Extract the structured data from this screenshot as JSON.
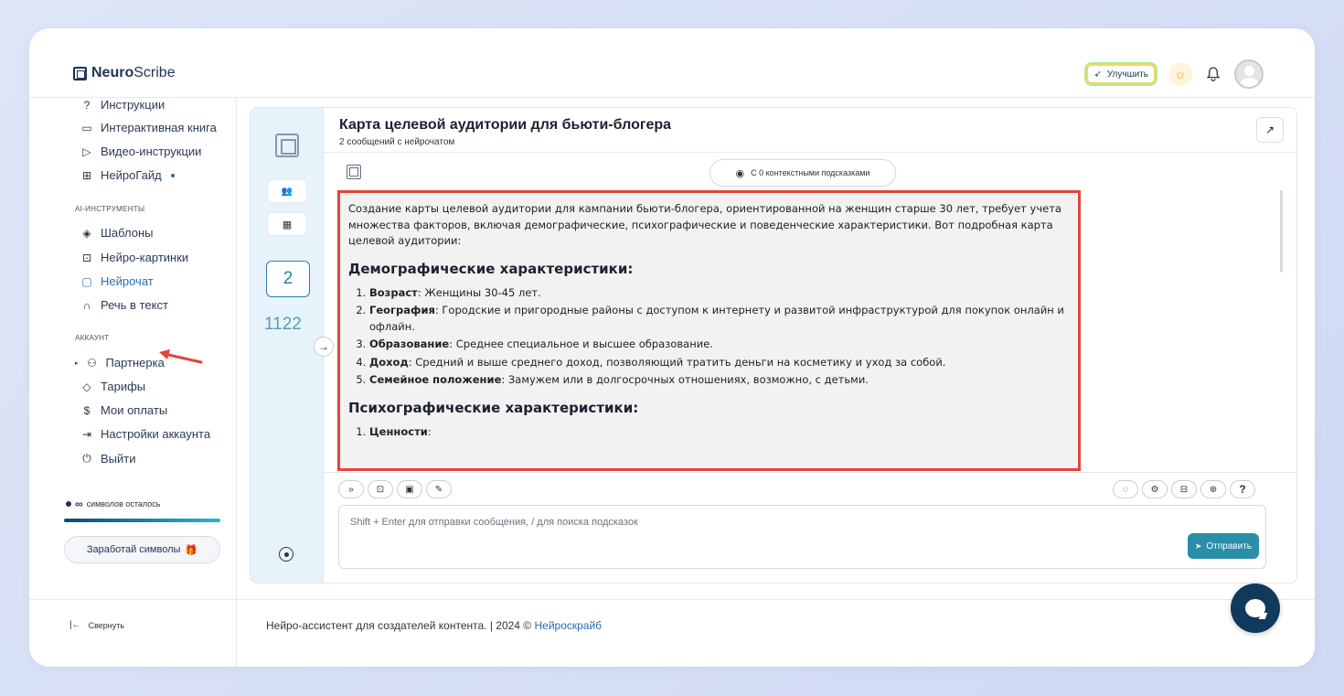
{
  "app": {
    "logo_bold": "Neuro",
    "logo_light": "Scribe"
  },
  "topbar": {
    "upgrade_label": "Улучшить",
    "sun_icon": "☼",
    "bell_icon": "🔔"
  },
  "sidebar": {
    "help_items": [
      {
        "icon": "?",
        "label": "Инструкции"
      },
      {
        "icon": "▭",
        "label": "Интерактивная книга"
      },
      {
        "icon": "▷",
        "label": "Видео-инструкции"
      },
      {
        "icon": "⊞",
        "label": "НейроГайд"
      }
    ],
    "ai_section_title": "AI-ИНСТРУМЕНТЫ",
    "ai_items": [
      {
        "icon": "◈",
        "label": "Шаблоны"
      },
      {
        "icon": "⊡",
        "label": "Нейро-картинки"
      },
      {
        "icon": "▢",
        "label": "Нейрочат"
      },
      {
        "icon": "∩",
        "label": "Речь в текст"
      }
    ],
    "account_section_title": "АККАУНТ",
    "account_items": [
      {
        "icon": "⚇",
        "label": "Партнерка"
      },
      {
        "icon": "◇",
        "label": "Тарифы"
      },
      {
        "icon": "$",
        "label": "Мои оплаты"
      },
      {
        "icon": "⇥",
        "label": "Настройки аккаунта"
      },
      {
        "icon": "⏻",
        "label": "Выйти"
      }
    ],
    "symbols_infinity": "∞",
    "symbols_label": "символов осталось",
    "earn_label": "Заработай символы",
    "earn_icon": "🎁"
  },
  "rail": {
    "count": "2",
    "number": "1122",
    "expand_icon": "→"
  },
  "chat": {
    "title": "Карта целевой аудитории для бьюти-блогера",
    "subtitle": "2 сообщений с нейрочатом",
    "share_icon": "↗",
    "context_label": "С 0 контекстными подсказками",
    "intro": "Создание карты целевой аудитории для кампании бьюти-блогера, ориентированной на женщин старше 30 лет, требует учета множества факторов, включая демографические, психографические и поведенческие характеристики. Вот подробная карта целевой аудитории:",
    "demo_heading": "Демографические характеристики:",
    "demo_items": [
      {
        "term": "Возраст",
        "text": ": Женщины 30-45 лет."
      },
      {
        "term": "География",
        "text": ": Городские и пригородные районы с доступом к интернету и развитой инфраструктурой для покупок онлайн и офлайн."
      },
      {
        "term": "Образование",
        "text": ": Среднее специальное и высшее образование."
      },
      {
        "term": "Доход",
        "text": ": Средний и выше среднего доход, позволяющий тратить деньги на косметику и уход за собой."
      },
      {
        "term": "Семейное положение",
        "text": ": Замужем или в долгосрочных отношениях, возможно, с детьми."
      }
    ],
    "psycho_heading": "Психографические характеристики:",
    "psycho_items": [
      {
        "term": "Ценности",
        "text": ":"
      }
    ],
    "left_tools": [
      "»",
      "⊡",
      "▣",
      "✎"
    ],
    "right_tools": [
      "◌",
      "⚙",
      "⊟",
      "⊕",
      "?"
    ],
    "input_placeholder": "Shift + Enter для отправки сообщения, / для поиска подсказок",
    "send_label": "Отправить",
    "send_icon": "➤"
  },
  "footer": {
    "collapse_label": "Свернуть",
    "collapse_icon": "|←",
    "text": "Нейро-ассистент для создателей контента.  | 2024 © ",
    "link": "Нейроскрайб"
  }
}
